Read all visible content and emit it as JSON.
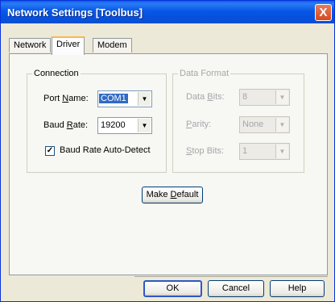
{
  "window": {
    "title": "Network Settings [Toolbus]",
    "close_label": "X"
  },
  "tabs": [
    {
      "label": "Network",
      "active": false
    },
    {
      "label": "Driver",
      "active": true
    },
    {
      "label": "Modem",
      "active": false
    }
  ],
  "connection": {
    "title": "Connection",
    "port_name": {
      "label_pre": "Port ",
      "label_u": "N",
      "label_post": "ame:",
      "value": "COM1",
      "arrow": "▼"
    },
    "baud_rate": {
      "label_pre": "Baud ",
      "label_u": "R",
      "label_post": "ate:",
      "value": "19200",
      "arrow": "▼"
    },
    "auto_detect": {
      "label": "Baud Rate Auto-Detect",
      "checked": true,
      "check_glyph": "✓"
    }
  },
  "data_format": {
    "title": "Data Format",
    "data_bits": {
      "label_pre": "Data ",
      "label_u": "B",
      "label_post": "its:",
      "value": "8",
      "arrow": "▼"
    },
    "parity": {
      "label_u": "P",
      "label_post": "arity:",
      "value": "None",
      "arrow": "▼"
    },
    "stop_bits": {
      "label_u": "S",
      "label_post": "top Bits:",
      "value": "1",
      "arrow": "▼"
    }
  },
  "make_default": {
    "label_pre": "Make ",
    "label_u": "D",
    "label_post": "efault"
  },
  "buttons": {
    "ok": "OK",
    "cancel": "Cancel",
    "help": "Help"
  },
  "colors": {
    "titlebar": "#0758e6",
    "selection": "#316ac5",
    "active_tab_accent": "#f9b84a"
  }
}
